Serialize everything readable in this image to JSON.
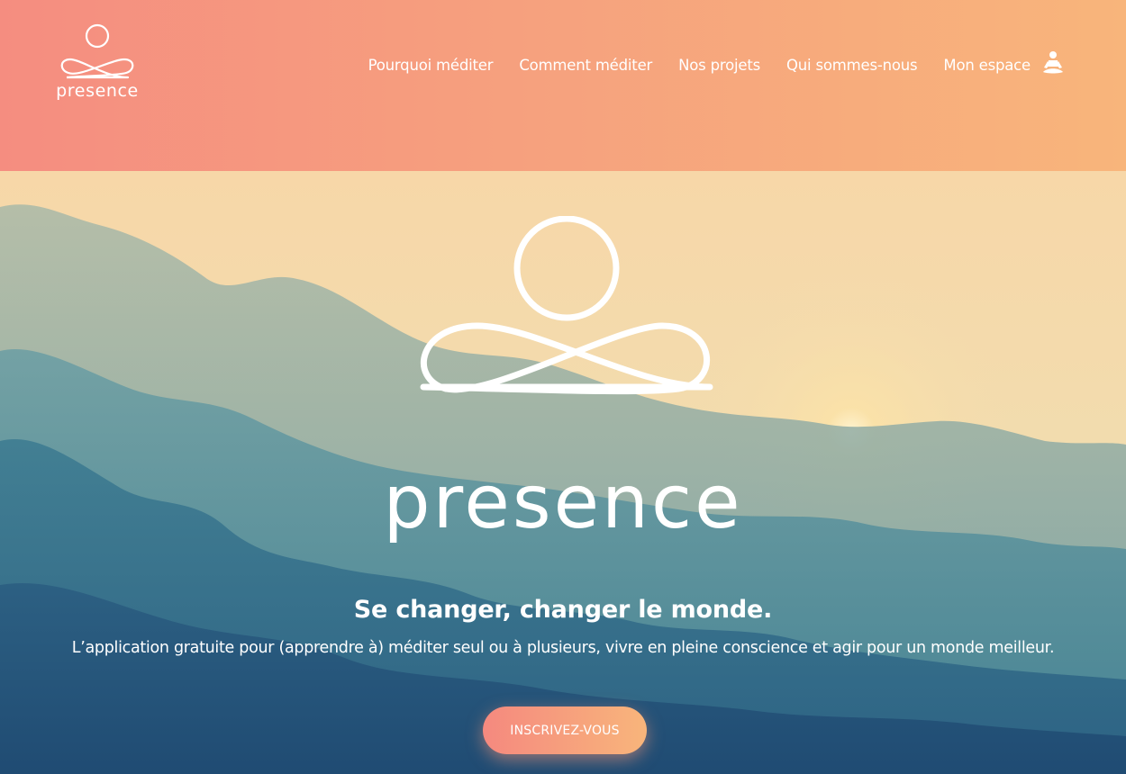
{
  "header": {
    "logo_text": "presence",
    "nav": [
      {
        "label": "Pourquoi méditer"
      },
      {
        "label": "Comment méditer"
      },
      {
        "label": "Nos projets"
      },
      {
        "label": "Qui sommes-nous"
      },
      {
        "label": "Mon espace",
        "icon": "meditation-user-icon"
      }
    ]
  },
  "hero": {
    "brand": "presence",
    "tagline": "Se changer, changer le monde.",
    "subtitle": "L’application gratuite pour (apprendre à) méditer seul ou à plusieurs, vivre en pleine conscience et agir pour un monde meilleur.",
    "cta_label": "INSCRIVEZ-VOUS",
    "background": "mountain-sunrise-image"
  },
  "colors": {
    "header_gradient_start": "#f58d80",
    "header_gradient_end": "#f8b57b",
    "text": "#ffffff"
  }
}
